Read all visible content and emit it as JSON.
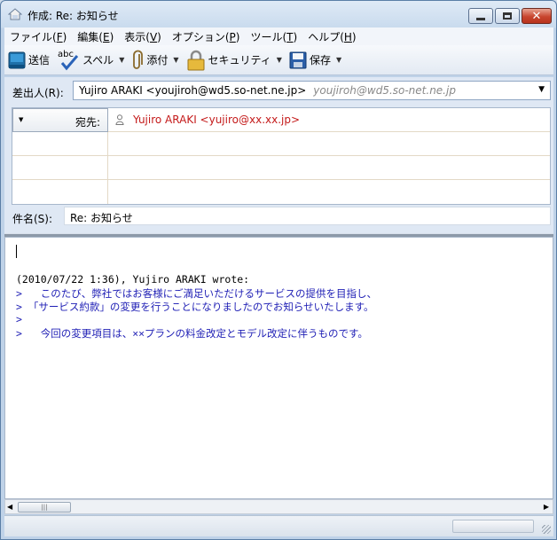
{
  "window": {
    "title": "作成: Re: お知らせ"
  },
  "menubar": {
    "items": [
      {
        "label": "ファイル(",
        "key": "F",
        "close": ")"
      },
      {
        "label": "編集(",
        "key": "E",
        "close": ")"
      },
      {
        "label": "表示(",
        "key": "V",
        "close": ")"
      },
      {
        "label": "オプション(",
        "key": "P",
        "close": ")"
      },
      {
        "label": "ツール(",
        "key": "T",
        "close": ")"
      },
      {
        "label": "ヘルプ(",
        "key": "H",
        "close": ")"
      }
    ]
  },
  "toolbar": {
    "send": "送信",
    "spell": "スペル",
    "spell_icon_text": "abc",
    "attach": "添付",
    "security": "セキュリティ",
    "save": "保存"
  },
  "compose": {
    "from_label": "差出人(R):",
    "from_identity": "Yujiro ARAKI <youjiroh@wd5.so-net.ne.jp>",
    "from_account": "youjiroh@wd5.so-net.ne.jp",
    "recipients": [
      {
        "type": "宛先:",
        "address": "Yujiro ARAKI <yujiro@xx.xx.jp>"
      },
      {
        "type": "",
        "address": ""
      },
      {
        "type": "",
        "address": ""
      },
      {
        "type": "",
        "address": ""
      }
    ],
    "subject_label": "件名(S):",
    "subject": "Re: お知らせ"
  },
  "body": {
    "attribution": "(2010/07/22 1:36), Yujiro ARAKI wrote:",
    "quoted_lines": [
      ">   このたび、弊社ではお客様にご満足いただけるサービスの提供を目指し、",
      "> 「サービス約款」の変更を行うことになりましたのでお知らせいたします。",
      ">",
      ">   今回の変更項目は、××プランの料金改定とモデル改定に伴うものです。"
    ]
  },
  "statusbar": {
    "text": ""
  },
  "colors": {
    "recipient_address": "#c41a1a",
    "quote_text": "#1f1fb5",
    "titlebar": "#dfeaf6"
  }
}
